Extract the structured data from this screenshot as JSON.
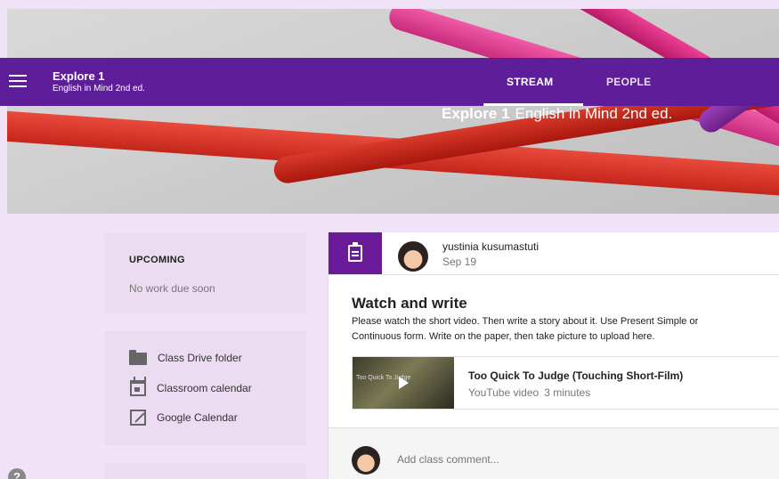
{
  "colors": {
    "appbar": "#5e1e9a",
    "accent": "#6a1b9a",
    "background": "#f1e3f7"
  },
  "header": {
    "class_name": "Explore 1",
    "class_section": "English in Mind 2nd ed.",
    "tabs": [
      {
        "label": "STREAM",
        "active": true
      },
      {
        "label": "PEOPLE",
        "active": false
      }
    ]
  },
  "banner": {
    "title_bold": "Explore 1",
    "title_rest": "English in Mind 2nd ed."
  },
  "sidebar": {
    "upcoming_title": "UPCOMING",
    "upcoming_empty": "No work due soon",
    "links": [
      {
        "label": "Class Drive folder",
        "icon": "folder-icon"
      },
      {
        "label": "Classroom calendar",
        "icon": "calendar-icon"
      },
      {
        "label": "Google Calendar",
        "icon": "open-in-new-icon"
      }
    ]
  },
  "post": {
    "type_icon": "assignment-icon",
    "author": "yustinia kusumastuti",
    "date": "Sep 19",
    "title": "Watch and write",
    "body_line1": "Please watch the short video. Then write a story about it. Use Present Simple or",
    "body_line2": "Continuous form. Write on the paper, then take picture to upload here.",
    "attachment": {
      "thumb_text": "Too Quick To Judge",
      "title": "Too Quick To Judge (Touching Short-Film)",
      "source": "YouTube video",
      "duration": "3 minutes"
    },
    "comment_placeholder": "Add class comment..."
  },
  "help_label": "?"
}
